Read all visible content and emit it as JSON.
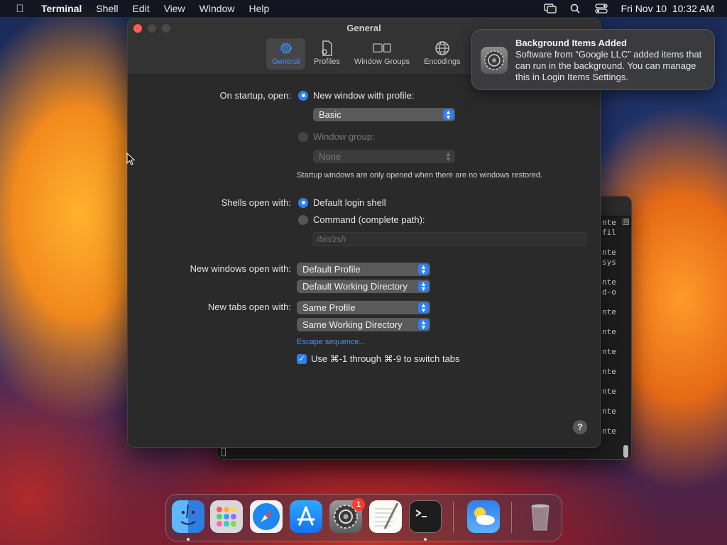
{
  "menubar": {
    "app_name": "Terminal",
    "items": [
      "Shell",
      "Edit",
      "View",
      "Window",
      "Help"
    ],
    "datetime": "Fri Nov 10  10:32 AM"
  },
  "prefs": {
    "title": "General",
    "tabs": [
      {
        "label": "General",
        "icon": "gear-icon",
        "active": true
      },
      {
        "label": "Profiles",
        "icon": "profiles-icon",
        "active": false
      },
      {
        "label": "Window Groups",
        "icon": "window-groups-icon",
        "active": false
      },
      {
        "label": "Encodings",
        "icon": "globe-icon",
        "active": false
      }
    ],
    "startup": {
      "label": "On startup, open:",
      "option1": "New window with profile:",
      "profile_value": "Basic",
      "option2": "Window group:",
      "group_value": "None",
      "note": "Startup windows are only opened when there are no windows restored."
    },
    "shells": {
      "label": "Shells open with:",
      "option1": "Default login shell",
      "option2": "Command (complete path):",
      "command_placeholder": "/bin/zsh"
    },
    "new_windows": {
      "label": "New windows open with:",
      "profile": "Default Profile",
      "directory": "Default Working Directory"
    },
    "new_tabs": {
      "label": "New tabs open with:",
      "profile": "Same Profile",
      "directory": "Same Working Directory"
    },
    "escape_link": "Escape sequence...",
    "switch_tabs_label": "Use ⌘-1 through ⌘-9 to switch tabs",
    "help": "?"
  },
  "terminal": {
    "lines": [
      "nte",
      "fil",
      "",
      "nte",
      "sys",
      "",
      "nte",
      "d-o",
      "",
      "nte",
      "",
      "nte",
      "",
      "nte",
      "",
      "nte",
      "",
      "nte",
      "",
      "nte",
      "",
      "nte"
    ]
  },
  "notification": {
    "title": "Background Items Added",
    "body": "Software from “Google LLC” added items that can run in the background. You can manage this in Login Items Settings."
  },
  "dock": {
    "badge_count": "1",
    "icons": [
      "finder-icon",
      "launchpad-icon",
      "safari-icon",
      "app-store-icon",
      "system-settings-icon",
      "textedit-icon",
      "terminal-icon",
      "weather-icon",
      "trash-icon"
    ]
  }
}
